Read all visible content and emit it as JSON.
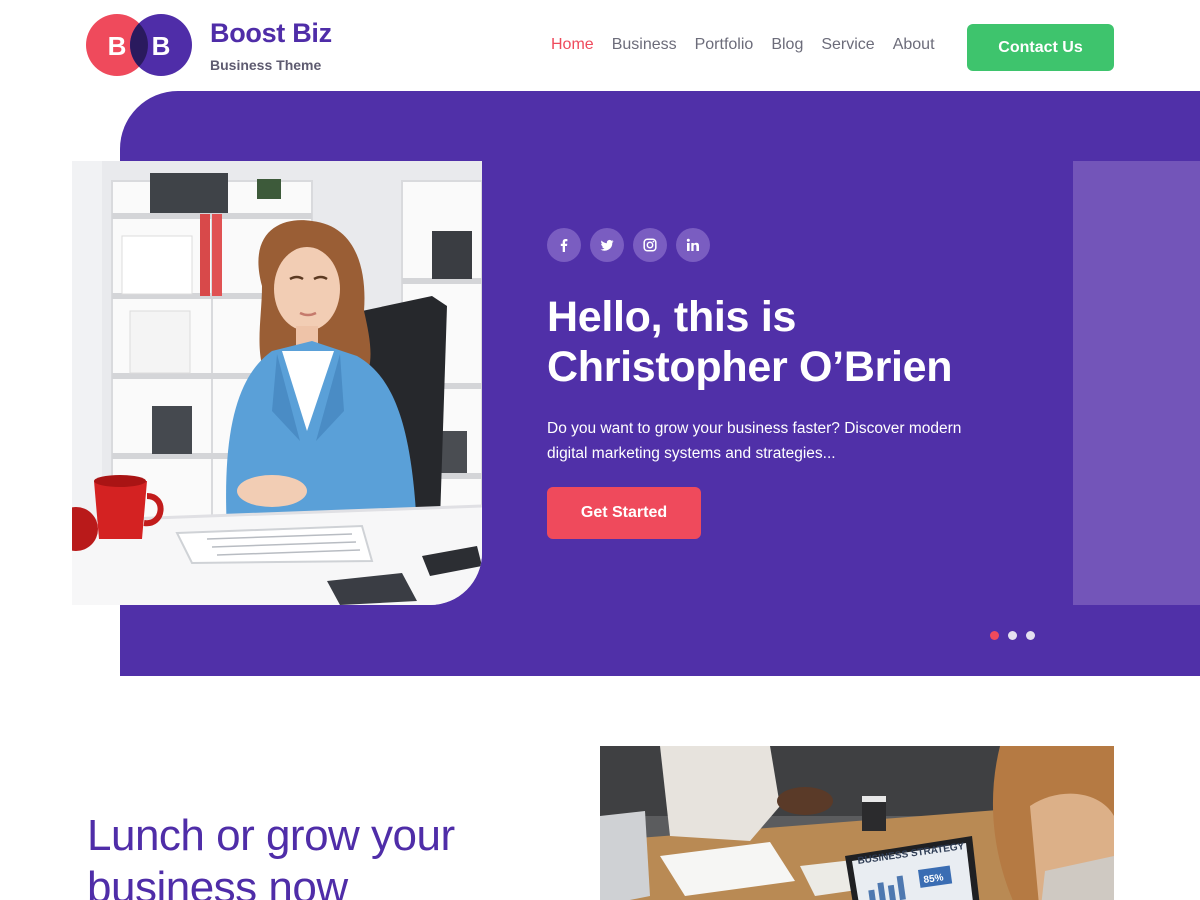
{
  "header": {
    "logo_letters": [
      "B",
      "B"
    ],
    "brand_title": "Boost Biz",
    "brand_subtitle": "Business Theme",
    "nav": [
      {
        "label": "Home",
        "active": true
      },
      {
        "label": "Business",
        "active": false
      },
      {
        "label": "Portfolio",
        "active": false
      },
      {
        "label": "Blog",
        "active": false
      },
      {
        "label": "Service",
        "active": false
      },
      {
        "label": "About",
        "active": false
      }
    ],
    "contact_label": "Contact Us"
  },
  "hero": {
    "socials": [
      "facebook-icon",
      "twitter-icon",
      "instagram-icon",
      "linkedin-icon"
    ],
    "title_line1": "Hello, this is",
    "title_line2": "Christopher O’Brien",
    "description_line1": "Do you want to grow your business faster? Discover modern",
    "description_line2": "digital marketing systems and strategies...",
    "cta_label": "Get Started",
    "slides": 3,
    "active_slide": 1
  },
  "section": {
    "title_line1": "Lunch or grow your",
    "title_line2": "business now",
    "screen_title": "BUSINESS STRATEGY",
    "screen_value": "85%"
  },
  "colors": {
    "brand_purple": "#5030a8",
    "accent_red": "#ef4a5c",
    "accent_green": "#3ec46d",
    "panel_purple": "#7355b9"
  }
}
